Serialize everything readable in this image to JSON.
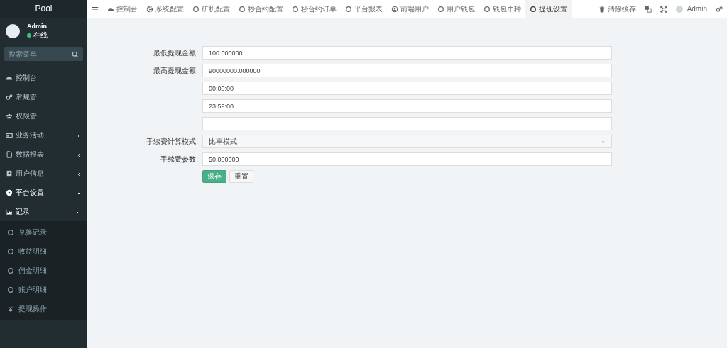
{
  "logo": "Pool",
  "user": {
    "name": "Admin",
    "status": "在线"
  },
  "search": {
    "placeholder": "搜索菜单"
  },
  "menu": [
    {
      "label": "控制台",
      "kind": "link",
      "expanded": false
    },
    {
      "label": "常规管",
      "kind": "link",
      "expanded": false
    },
    {
      "label": "权限管",
      "kind": "link",
      "expanded": false
    },
    {
      "label": "业务活动",
      "kind": "group",
      "expanded": false
    },
    {
      "label": "数据报表",
      "kind": "group",
      "expanded": false
    },
    {
      "label": "用户信息",
      "kind": "group",
      "expanded": false
    },
    {
      "label": "平台设置",
      "kind": "group",
      "expanded": true
    },
    {
      "label": "记录",
      "kind": "group",
      "expanded": true,
      "children": [
        {
          "label": "兑换记录"
        },
        {
          "label": "收益明细"
        },
        {
          "label": "佣金明细"
        },
        {
          "label": "账户明细"
        },
        {
          "label": "提现操作"
        }
      ]
    }
  ],
  "tabs": [
    {
      "label": "控制台",
      "selected": false
    },
    {
      "label": "系统配置",
      "selected": false
    },
    {
      "label": "矿机配置",
      "selected": false
    },
    {
      "label": "秒合约配置",
      "selected": false
    },
    {
      "label": "秒合约订单",
      "selected": false
    },
    {
      "label": "平台报表",
      "selected": false
    },
    {
      "label": "前端用户",
      "selected": false
    },
    {
      "label": "用户钱包",
      "selected": false
    },
    {
      "label": "钱包币种",
      "selected": false
    },
    {
      "label": "提现设置",
      "selected": true
    }
  ],
  "toolbar": {
    "clear_cache": "清除缓存",
    "admin": "Admin"
  },
  "form": {
    "fields": [
      {
        "kind": "text",
        "label": "最低提现金额:",
        "value": "100.000000"
      },
      {
        "kind": "text",
        "label": "最高提现金额:",
        "value": "90000000.000000"
      },
      {
        "kind": "text",
        "value": "00:00:00"
      },
      {
        "kind": "text",
        "value": "23:59:00"
      },
      {
        "kind": "text"
      },
      {
        "kind": "select",
        "label": "手续费计算模式:",
        "value": "比率模式"
      },
      {
        "kind": "text",
        "label": "手续费参数:",
        "value": "50.000000"
      }
    ],
    "buttons": [
      {
        "label": "保存",
        "kind": "primary"
      },
      {
        "label": "重置",
        "kind": "default"
      }
    ]
  }
}
